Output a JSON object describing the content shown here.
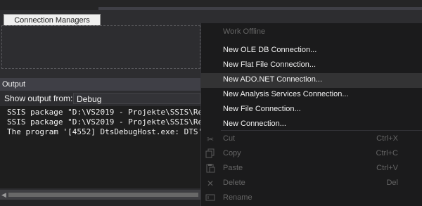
{
  "connection_managers": {
    "tab_label": "Connection Managers"
  },
  "output": {
    "title": "Output",
    "show_output_from_label": "Show output from:",
    "source_selected": "Debug",
    "lines": [
      "SSIS package \"D:\\VS2019 - Projekte\\SSIS\\Re",
      "SSIS package \"D:\\VS2019 - Projekte\\SSIS\\Re",
      "The program '[4552] DtsDebugHost.exe: DTS'"
    ]
  },
  "context_menu": {
    "items": [
      {
        "label": "Work Offline",
        "enabled": false
      },
      {
        "label": "New OLE DB Connection...",
        "enabled": true
      },
      {
        "label": "New Flat File Connection...",
        "enabled": true
      },
      {
        "label": "New ADO.NET Connection...",
        "enabled": true,
        "highlighted": true
      },
      {
        "label": "New Analysis Services Connection...",
        "enabled": true
      },
      {
        "label": "New File Connection...",
        "enabled": true
      },
      {
        "label": "New Connection...",
        "enabled": true
      },
      {
        "label": "Cut",
        "shortcut": "Ctrl+X",
        "icon": "scissors-icon",
        "enabled": false
      },
      {
        "label": "Copy",
        "shortcut": "Ctrl+C",
        "icon": "copy-icon",
        "enabled": false
      },
      {
        "label": "Paste",
        "shortcut": "Ctrl+V",
        "icon": "paste-icon",
        "enabled": false
      },
      {
        "label": "Delete",
        "shortcut": "Del",
        "icon": "delete-x-icon",
        "enabled": false
      },
      {
        "label": "Rename",
        "icon": "rename-icon",
        "enabled": false
      }
    ]
  },
  "colors": {
    "menu_background": "#1b1b1c",
    "menu_highlight": "#333334",
    "disabled_text": "#656565",
    "panel_background": "#2d2d30",
    "editor_background": "#1e1e1e"
  }
}
